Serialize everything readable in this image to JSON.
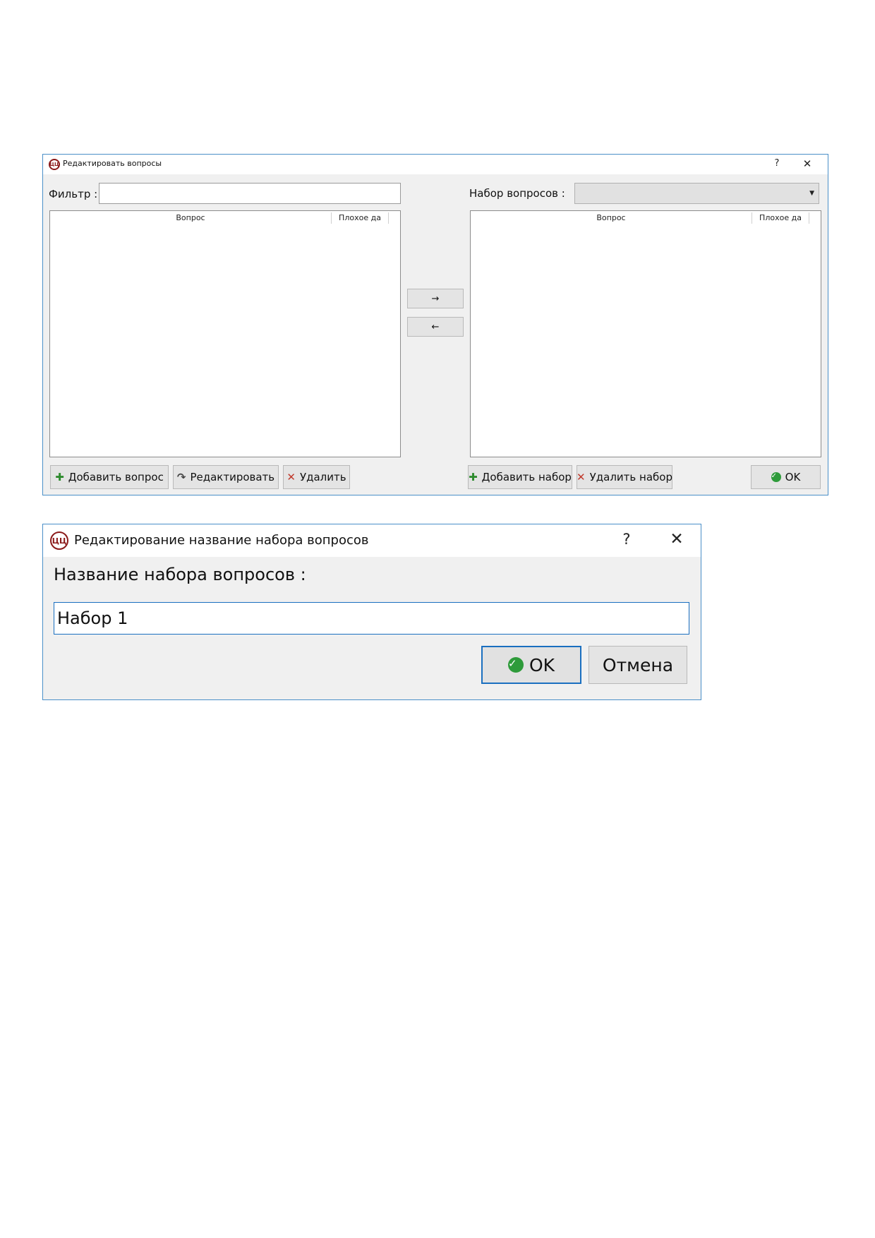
{
  "dialog1": {
    "title": "Редактировать вопросы",
    "help": "?",
    "close": "✕",
    "filter_label": "Фильтр :",
    "filter_value": "",
    "set_label": "Набор вопросов :",
    "set_selected": "",
    "left_table": {
      "columns": [
        "Вопрос",
        "Плохое да"
      ]
    },
    "right_table": {
      "columns": [
        "Вопрос",
        "Плохое да"
      ]
    },
    "move_right": "→",
    "move_left": "←",
    "buttons": {
      "add_question": "Добавить вопрос",
      "edit": "Редактировать",
      "delete": "Удалить",
      "add_set": "Добавить набор",
      "delete_set": "Удалить набор",
      "ok": "OK"
    }
  },
  "dialog2": {
    "title": "Редактирование название набора вопросов",
    "help": "?",
    "close": "✕",
    "field_label": "Название набора вопросов :",
    "field_value": "Набор 1",
    "ok": "OK",
    "cancel": "Отмена"
  },
  "icons": {
    "app": "app-logo-icon",
    "plus": "plus-icon",
    "x": "delete-x-icon",
    "redo": "redo-icon",
    "check": "check-circle-icon",
    "dropdown": "chevron-down-icon"
  },
  "colors": {
    "window_border": "#4a8fc8",
    "window_bg": "#f0f0f0",
    "plus_green": "#2e8b2e",
    "delete_red": "#c0392b",
    "ok_green": "#2e9b3a",
    "focus_blue": "#1a6fc0"
  }
}
